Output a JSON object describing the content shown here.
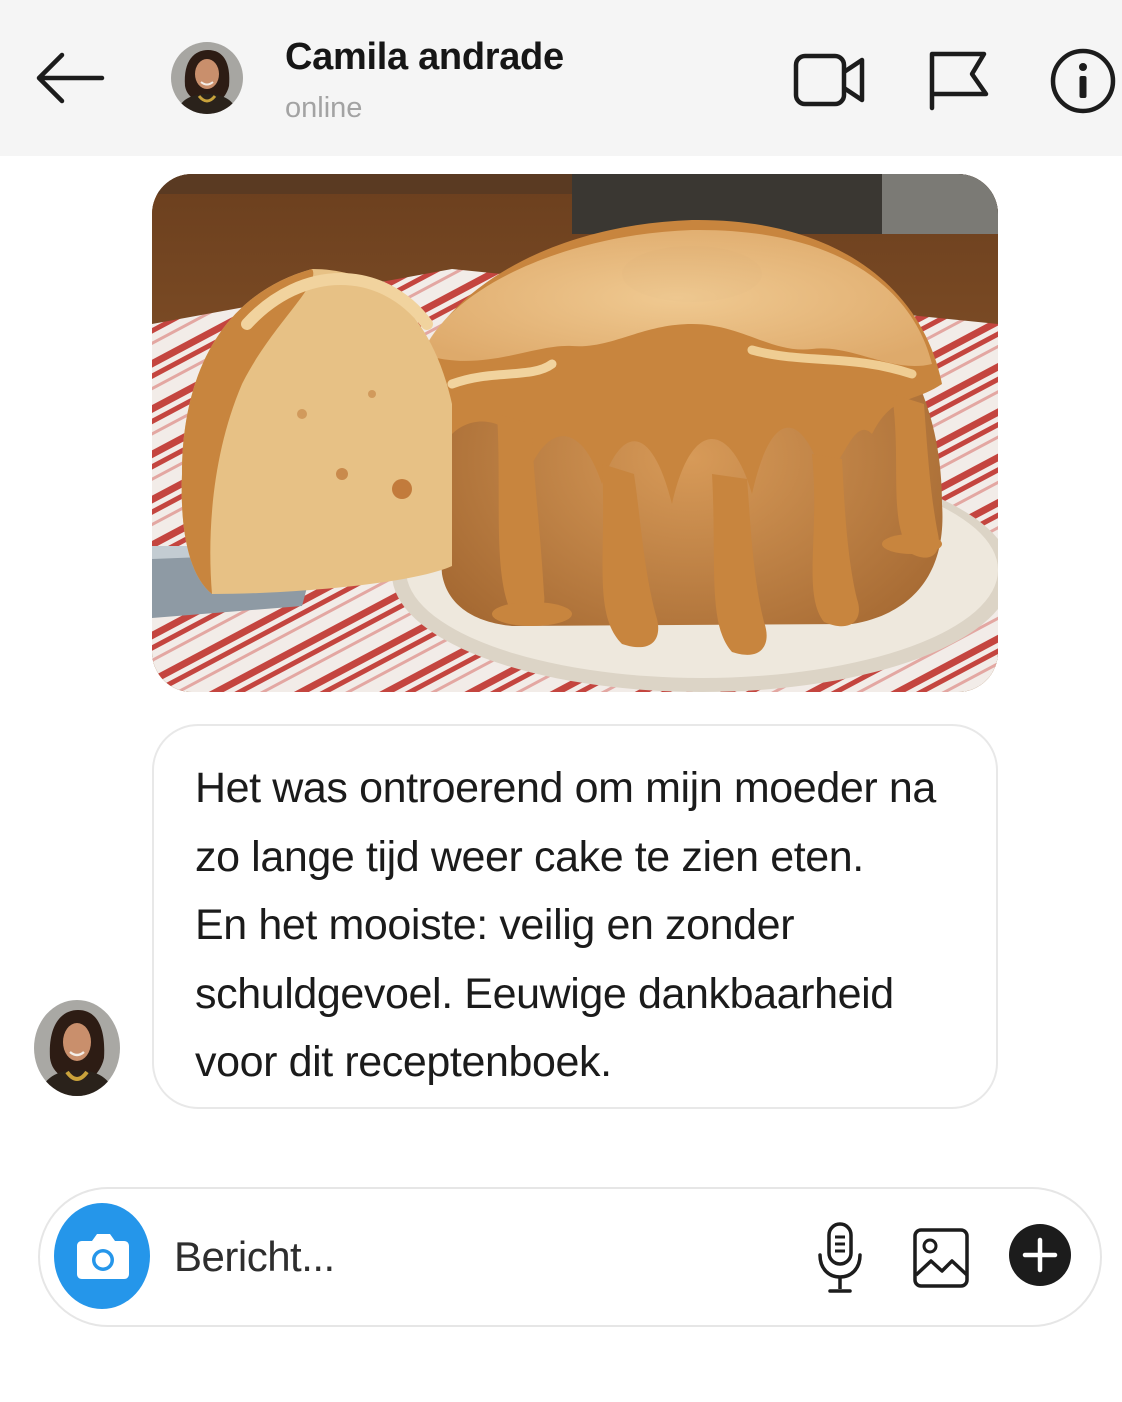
{
  "header": {
    "contact_name": "Camila andrade",
    "status": "online",
    "icons": {
      "back": "arrow-left-icon",
      "video": "video-camera-icon",
      "flag": "flag-icon",
      "info": "info-icon"
    }
  },
  "conversation": {
    "messages": [
      {
        "type": "image",
        "depicts": "bundt-cake"
      },
      {
        "type": "text",
        "lines": [
          "Het was ontroerend om mijn moeder na",
          "zo lange tijd weer cake te zien eten.",
          "En het mooiste: veilig en zonder",
          "schuldgevoel. Eeuwige dankbaarheid",
          "voor dit receptenboek."
        ]
      }
    ]
  },
  "composer": {
    "placeholder": "Bericht...",
    "value": "",
    "icons": {
      "camera": "camera-icon",
      "mic": "microphone-icon",
      "gallery": "image-icon",
      "add": "plus-icon"
    }
  },
  "colors": {
    "header_bg": "#f5f5f5",
    "status_text": "#a3a3a3",
    "camera_button": "#2596ea",
    "bubble_border": "#e8e8e8",
    "plus_button": "#1c1c1c"
  }
}
